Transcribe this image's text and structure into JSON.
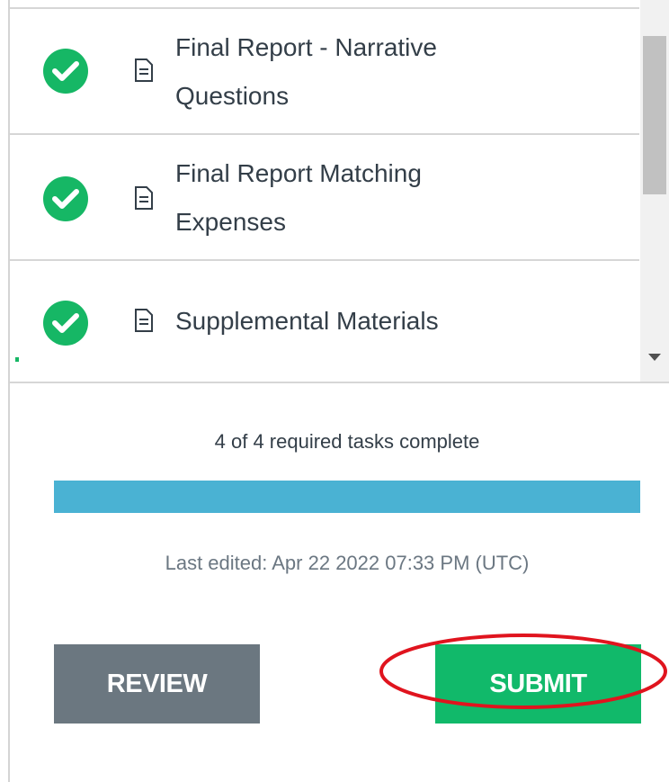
{
  "tasks": [
    {
      "label_line1": "Final Report - Narrative",
      "label_line2": "Questions",
      "status": "complete",
      "icon": "check-circle-icon",
      "doc_icon": "document-icon"
    },
    {
      "label_line1": "Final Report Matching",
      "label_line2": "Expenses",
      "status": "complete",
      "icon": "check-circle-icon",
      "doc_icon": "document-icon"
    },
    {
      "label_line1": "Supplemental Materials",
      "label_line2": "",
      "status": "complete",
      "icon": "check-circle-icon",
      "doc_icon": "document-icon"
    }
  ],
  "progress": {
    "text": "4 of 4 required tasks complete",
    "completed": 4,
    "total": 4,
    "fraction": 1.0,
    "color": "#4ab2d3"
  },
  "last_edited": "Last edited: Apr 22 2022 07:33 PM (UTC)",
  "actions": {
    "review_label": "REVIEW",
    "submit_label": "SUBMIT",
    "review_color": "#6b7780",
    "submit_color": "#11b96a"
  },
  "annotation": {
    "shape": "ellipse",
    "color": "#e0141e",
    "target": "submit-button"
  },
  "colors": {
    "check_green": "#16b765",
    "text_primary": "#333e48",
    "text_secondary": "#6b7782"
  }
}
